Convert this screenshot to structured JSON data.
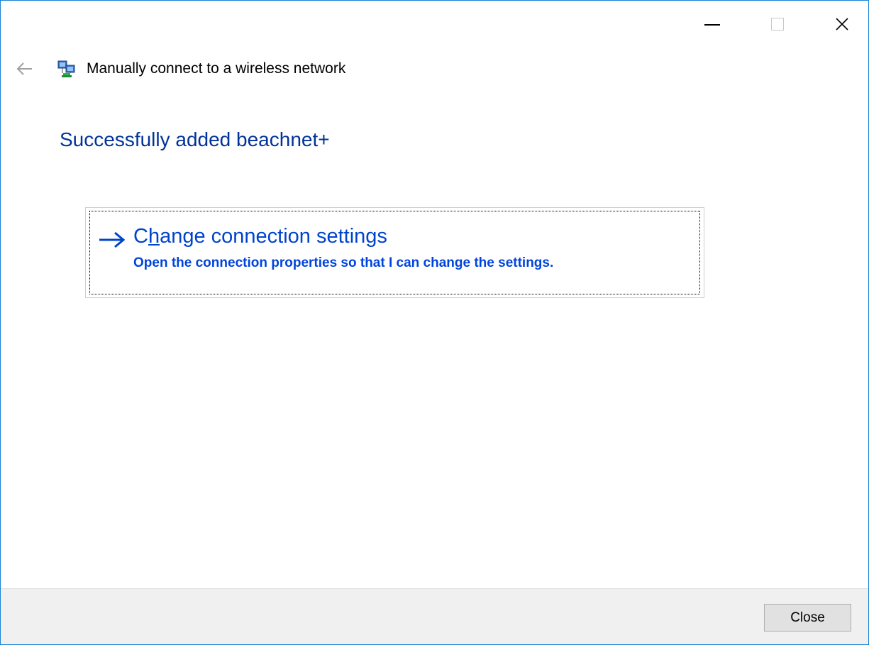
{
  "window": {
    "controls": {
      "minimize_icon": "minimize-icon",
      "maximize_icon": "maximize-icon",
      "close_icon": "close-icon"
    }
  },
  "header": {
    "back_icon": "back-arrow-icon",
    "network_icon": "network-icon",
    "title": "Manually connect to a wireless network"
  },
  "main": {
    "heading": "Successfully added beachnet+",
    "command_link": {
      "arrow_icon": "right-arrow-icon",
      "title_prefix": "C",
      "title_mnemonic": "h",
      "title_suffix": "ange connection settings",
      "description": "Open the connection properties so that I can change the settings."
    }
  },
  "footer": {
    "close_label": "Close"
  },
  "colors": {
    "heading": "#003399",
    "link": "#0044cc",
    "window_border": "#1883d7",
    "footer_bg": "#f0f0f0"
  }
}
